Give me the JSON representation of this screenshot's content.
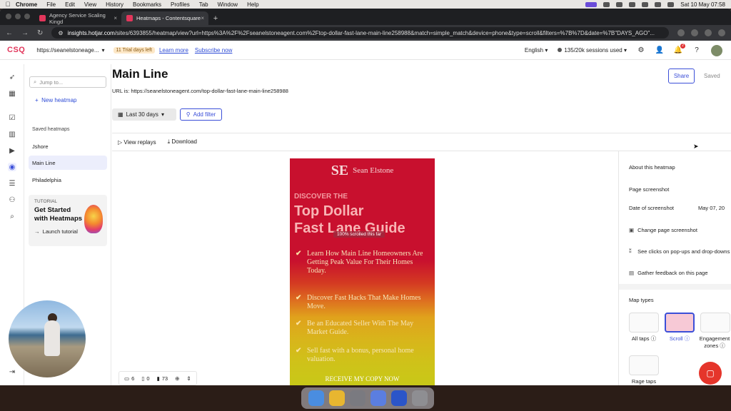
{
  "menubar": {
    "apple": "",
    "items": [
      "Chrome",
      "File",
      "Edit",
      "View",
      "History",
      "Bookmarks",
      "Profiles",
      "Tab",
      "Window",
      "Help"
    ],
    "clock": "Sat 10 May 07:58"
  },
  "browser": {
    "tabs": [
      {
        "label": "Agency Service Scaling Kingd",
        "close": "×"
      },
      {
        "label": "Heatmaps - Contentsquare",
        "close": "×"
      }
    ],
    "new_tab": "+",
    "url_host": "insights.hotjar.com",
    "url_rest": "/sites/6393855/heatmap/view?url=https%3A%2F%2Fseanelstoneagent.com%2Ftop-dollar-fast-lane-main-line258988&match=simple_match&device=phone&type=scroll&filters=%7B%7D&date=%7B\"DAYS_AGO\"...",
    "nav": {
      "back": "←",
      "forward": "→",
      "reload": "↻"
    }
  },
  "app_header": {
    "logo_prefix": "CSQ",
    "site": "https://seanelstoneage...",
    "site_chevron": "▾",
    "trial": "11 Trial days left",
    "learn_more": "Learn more",
    "subscribe": "Subscribe now",
    "language": "English",
    "sessions": "135/20k sessions used",
    "notifications_count": "2"
  },
  "sidebar": {
    "search_placeholder": "Jump to...",
    "new_heatmap": "New heatmap",
    "section": "Saved heatmaps",
    "items": [
      {
        "label": "Jshore"
      },
      {
        "label": "Main Line"
      },
      {
        "label": "Philadelphia"
      }
    ],
    "tutorial": {
      "tag": "TUTORIAL",
      "title": "Get Started with Heatmaps",
      "launch": "Launch tutorial"
    }
  },
  "main": {
    "title": "Main Line",
    "url_line": "URL is: https://seanelstoneagent.com/top-dollar-fast-lane-main-line258988",
    "share": "Share",
    "saved": "Saved",
    "date_range": "Last 30 days",
    "add_filter": "Add filter",
    "view_replays": "View replays",
    "download": "Download"
  },
  "heatmap": {
    "logo_mark": "SE",
    "logo_text": "Sean Elstone",
    "kicker": "DISCOVER THE",
    "headline_1": "Top Dollar",
    "headline_2": "Fast Lane Guide",
    "scroll_label": "100% scrolled this far",
    "bullets": [
      {
        "text": "Learn How Main Line Homeowners Are Getting Peak Value For Their Homes Today."
      },
      {
        "text": "Discover Fast Hacks That Make Homes Move."
      },
      {
        "text": "Be an Educated Seller With The May Market Guide."
      },
      {
        "text": "Sell fast with a bonus, personal home valuation."
      }
    ],
    "cta": "RECEIVE MY COPY NOW",
    "check": "✔"
  },
  "right_panel": {
    "about": "About this heatmap",
    "page_screenshot": "Page screenshot",
    "date_label": "Date of screenshot",
    "date_value": "May 07, 20",
    "change_screenshot": "Change page screenshot",
    "see_clicks": "See clicks on pop-ups and drop-downs",
    "gather_feedback": "Gather feedback on this page",
    "map_types_title": "Map types",
    "map_types": [
      {
        "label": "All taps ⓘ"
      },
      {
        "label": "Scroll ⓘ"
      },
      {
        "label": "Engagement zones ⓘ"
      },
      {
        "label": "Rage taps"
      }
    ]
  },
  "stats": {
    "desktop": "6",
    "tablet": "0",
    "phone": "73"
  },
  "colors": {
    "accent": "#3b4fd8",
    "brand": "#e2365b",
    "heat_red": "#c8102e",
    "heat_yellow": "#c8c818"
  }
}
